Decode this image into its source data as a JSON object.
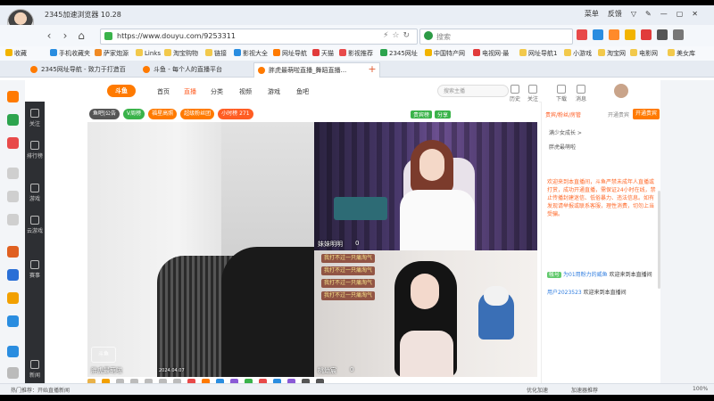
{
  "browser": {
    "title": "2345加速浏览器 10.28",
    "title_right": [
      "菜单",
      "反馈"
    ],
    "url": "https://www.douyu.com/9253311",
    "search_placeholder": "搜索"
  },
  "bookmarks": [
    "收藏",
    "手机收藏夹",
    "萨家炮源",
    "Links",
    "淘宝购物",
    "链接",
    "影视大全",
    "网址导航",
    "天猫",
    "影视推荐",
    "2345网址",
    "中国特产网",
    "电视网·最",
    "网址导航1",
    "小游戏",
    "淘宝网",
    "电影网",
    "美女库"
  ],
  "tabs": [
    {
      "label": "2345网址导航 - 致力于打造百",
      "active": false
    },
    {
      "label": "斗鱼 - 每个人的直播平台",
      "active": false
    },
    {
      "label": "胖虎最萌啦直播_舞蹈直播...",
      "active": true
    }
  ],
  "douyu_nav": {
    "logo": "斗鱼",
    "links": [
      "首页",
      "直播",
      "分类",
      "视频",
      "游戏",
      "鱼吧"
    ],
    "active_link": "直播",
    "search_placeholder": "搜索主播",
    "right_items": [
      "历史",
      "关注",
      "下载",
      "消息"
    ]
  },
  "side_nav": [
    "关注",
    "排行榜",
    "游戏",
    "云游戏",
    "赛事",
    "新闻"
  ],
  "room": {
    "tags": [
      "鱼吧|公告",
      "V周榜",
      "福星高照",
      "超级粉丝团",
      "小时榜 271"
    ],
    "tags_right": [
      "贵宾榜",
      "分享"
    ]
  },
  "video": {
    "tile1_label": "胖虎最萌啦",
    "tile2_label": "妹妹明明",
    "tile3_label": "桃幼宸",
    "tile3_num": "0",
    "tile2_num": "0",
    "danmu": [
      "我打不过一只痛淘气",
      "我打不过一只痛淘气",
      "我打不过一只痛淘气",
      "我打不过一只痛淘气"
    ],
    "watermark": "斗鱼",
    "timestamp": "2024.04.07"
  },
  "chat": {
    "head_link": "贵宾/粉丝/房管",
    "head_hint": "开通贵宾",
    "cta": "开通贵宾",
    "line1": "满少女成长 >",
    "line2": "胖虎最萌啦",
    "system_msg": "欢迎来到本直播间，斗鱼严禁未成年人直播或打赏，成功开通直播，需保证24小时在线，禁止传播封建迷信、低俗暴力、违法信息。如有发现请举报或联系客服，理性消费，切勿上当受骗。",
    "messages": [
      {
        "badge": "帐号",
        "user": "为01用粉力的威鱼",
        "text": "欢迎来到本直播间"
      },
      {
        "badge": "",
        "user": "用户2023523",
        "text": "欢迎来到本直播间"
      }
    ]
  },
  "statusbar": {
    "left": "热门推荐：开始直播新闻",
    "right_items": [
      "优化加速",
      "加速器推荐",
      "100%"
    ]
  }
}
